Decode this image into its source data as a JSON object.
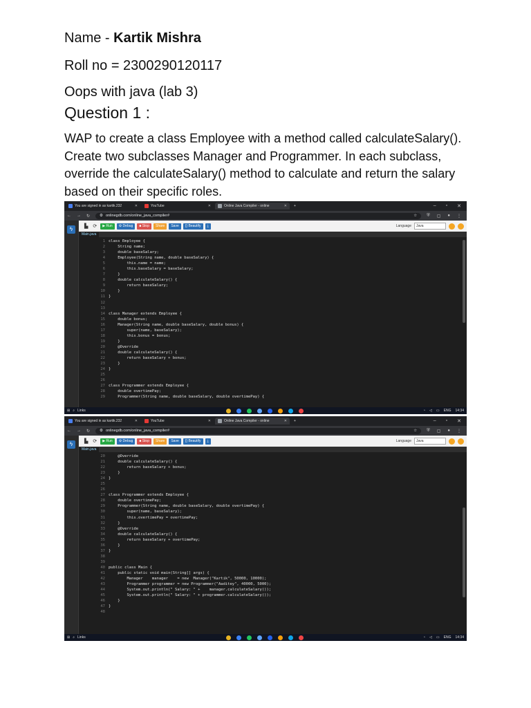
{
  "doc": {
    "name_label": "Name  -",
    "name_value": "Kartik Mishra",
    "roll": "Roll no = 2300290120117",
    "course": "Oops with java (lab 3)",
    "question": "Question 1 :",
    "prompt": "WAP to create a class Employee with a method called calculateSalary(). Create two subclasses Manager and Programmer. In each subclass, override the calculateSalary() method to calculate and return the salary based on their specific roles."
  },
  "browser": {
    "tab1": "You are signed in as kartik.232",
    "tab2": "YouTube",
    "tab3": "Online Java Compiler - online",
    "url": "onlinegdb.com/online_java_compiler#"
  },
  "gdb": {
    "run": "▶ Run",
    "debug": "⚙ Debug",
    "stop": "■ Stop",
    "share": "Share",
    "save": "Save",
    "beautify": "{} Beautify",
    "language_label": "Language",
    "language_value": "Java",
    "file_tab": "Main.java"
  },
  "taskbar": {
    "search": "Links",
    "lang": "ENG",
    "time": "14:34"
  },
  "code1": [
    {
      "n": "1",
      "t": "class Employee {"
    },
    {
      "n": "2",
      "t": "    String name;"
    },
    {
      "n": "3",
      "t": "    double baseSalary;"
    },
    {
      "n": "4",
      "t": "    Employee(String name, double baseSalary) {"
    },
    {
      "n": "5",
      "t": "        this.name = name;"
    },
    {
      "n": "6",
      "t": "        this.baseSalary = baseSalary;"
    },
    {
      "n": "7",
      "t": "    }"
    },
    {
      "n": "8",
      "t": "    double calculateSalary() {"
    },
    {
      "n": "9",
      "t": "        return baseSalary;"
    },
    {
      "n": "10",
      "t": "    }"
    },
    {
      "n": "11",
      "t": "}"
    },
    {
      "n": "12",
      "t": ""
    },
    {
      "n": "13",
      "t": ""
    },
    {
      "n": "14",
      "t": "class Manager extends Employee {"
    },
    {
      "n": "15",
      "t": "    double bonus;"
    },
    {
      "n": "16",
      "t": "    Manager(String name, double baseSalary, double bonus) {"
    },
    {
      "n": "17",
      "t": "        super(name, baseSalary);"
    },
    {
      "n": "18",
      "t": "        this.bonus = bonus;"
    },
    {
      "n": "19",
      "t": "    }"
    },
    {
      "n": "20",
      "t": "    @Override"
    },
    {
      "n": "21",
      "t": "    double calculateSalary() {"
    },
    {
      "n": "22",
      "t": "        return baseSalary + bonus;"
    },
    {
      "n": "23",
      "t": "    }"
    },
    {
      "n": "24",
      "t": "}"
    },
    {
      "n": "25",
      "t": ""
    },
    {
      "n": "26",
      "t": ""
    },
    {
      "n": "27",
      "t": "class Programmer extends Employee {"
    },
    {
      "n": "28",
      "t": "    double overtimePay;"
    },
    {
      "n": "29",
      "t": "    Programmer(String name, double baseSalary, double overtimePay) {"
    }
  ],
  "code2": [
    {
      "n": "20",
      "t": "    @Override"
    },
    {
      "n": "21",
      "t": "    double calculateSalary() {"
    },
    {
      "n": "22",
      "t": "        return baseSalary + bonus;"
    },
    {
      "n": "23",
      "t": "    }"
    },
    {
      "n": "24",
      "t": "}"
    },
    {
      "n": "25",
      "t": ""
    },
    {
      "n": "26",
      "t": ""
    },
    {
      "n": "27",
      "t": "class Programmer extends Employee {"
    },
    {
      "n": "28",
      "t": "    double overtimePay;"
    },
    {
      "n": "29",
      "t": "    Programmer(String name, double baseSalary, double overtimePay) {"
    },
    {
      "n": "30",
      "t": "        super(name, baseSalary);"
    },
    {
      "n": "31",
      "t": "        this.overtimePay = overtimePay;"
    },
    {
      "n": "32",
      "t": "    }"
    },
    {
      "n": "33",
      "t": "    @Override"
    },
    {
      "n": "34",
      "t": "    double calculateSalary() {"
    },
    {
      "n": "35",
      "t": "        return baseSalary + overtimePay;"
    },
    {
      "n": "36",
      "t": "    }"
    },
    {
      "n": "37",
      "t": "}"
    },
    {
      "n": "38",
      "t": ""
    },
    {
      "n": "39",
      "t": ""
    },
    {
      "n": "40",
      "t": "public class Main {"
    },
    {
      "n": "41",
      "t": "    public static void main(String[] args) {"
    },
    {
      "n": "42",
      "t": "        Manager    manager    = new  Manager(\"Kartik\", 50000, 10000);"
    },
    {
      "n": "43",
      "t": "        Programmer programmer = new Programmer(\"Aaditey\", 40000, 5000);"
    },
    {
      "n": "44",
      "t": "        System.out.println(\" Salary: \" +    manager.calculateSalary());"
    },
    {
      "n": "45",
      "t": "        System.out.println(\" Salary: \" + programmer.calculateSalary());"
    },
    {
      "n": "46",
      "t": "    }"
    },
    {
      "n": "47",
      "t": "}"
    },
    {
      "n": "48",
      "t": ""
    }
  ]
}
